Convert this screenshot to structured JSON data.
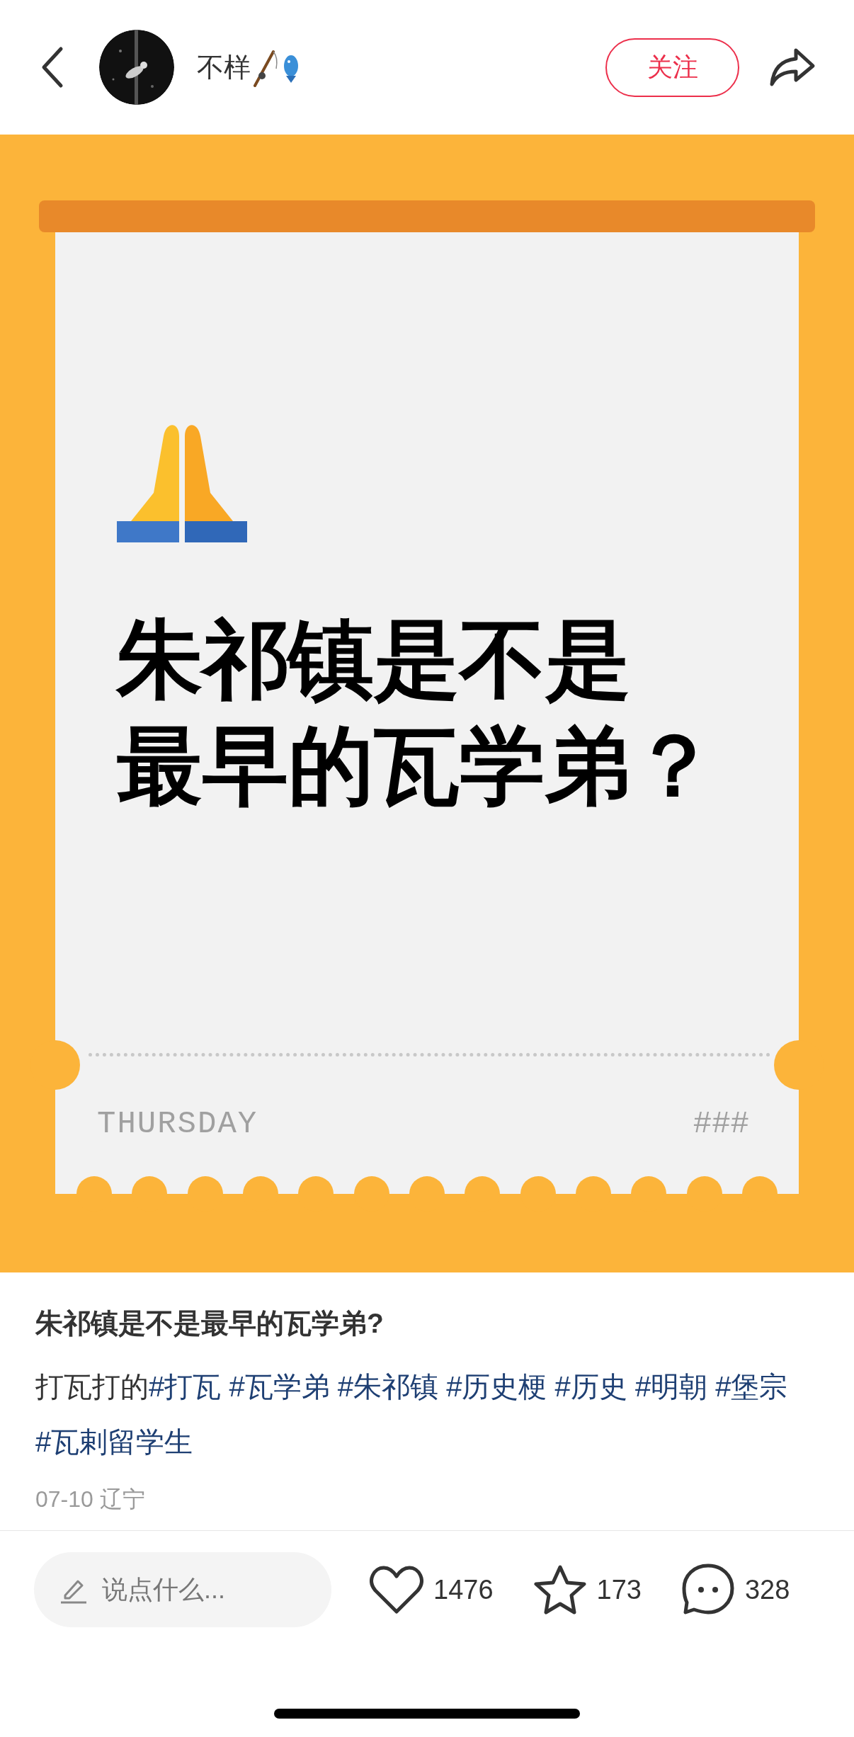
{
  "header": {
    "username": "不样",
    "follow_button": "关注"
  },
  "post_image": {
    "headline_lines": [
      "朱祁镇是不是",
      "最早的瓦学弟？"
    ],
    "footer_left": "THURSDAY",
    "footer_right": "###"
  },
  "post": {
    "title": "朱祁镇是不是最早的瓦学弟?",
    "body": "打瓦打的",
    "tags": [
      "#打瓦",
      "#瓦学弟",
      "#朱祁镇",
      "#历史梗",
      "#历史",
      "#明朝",
      "#堡宗",
      "#瓦剌留学生"
    ],
    "meta": "07-10 辽宁"
  },
  "bottom_bar": {
    "comment_placeholder": "说点什么...",
    "likes": "1476",
    "favorites": "173",
    "comments": "328"
  }
}
